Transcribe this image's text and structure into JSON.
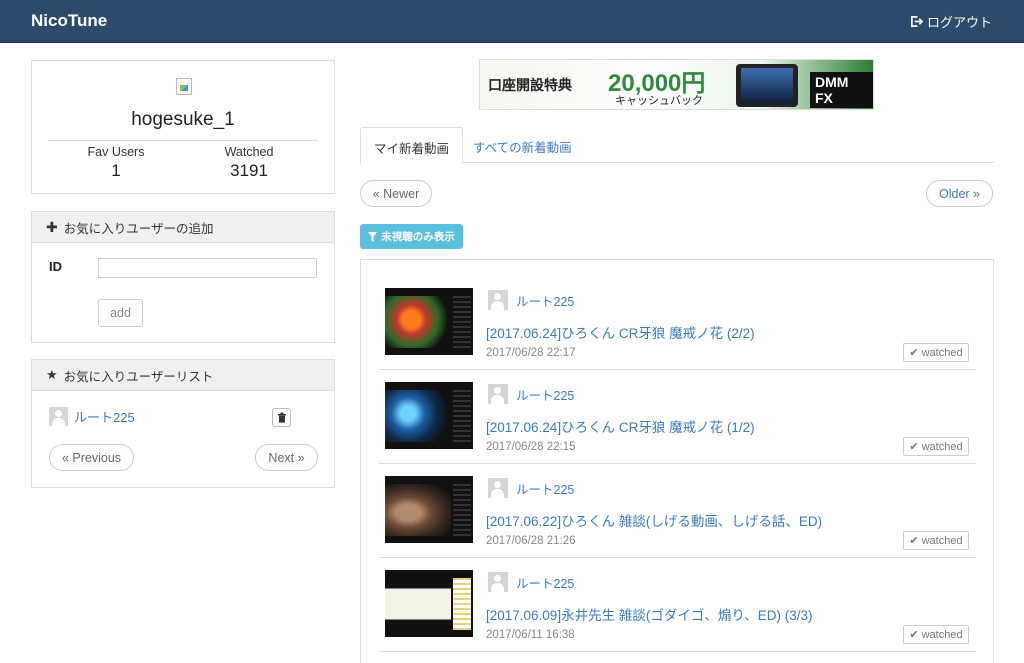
{
  "navbar": {
    "brand": "NicoTune",
    "logout_label": "ログアウト"
  },
  "profile": {
    "username": "hogesuke_1",
    "fav_users_label": "Fav Users",
    "fav_users_count": "1",
    "watched_label": "Watched",
    "watched_count": "3191"
  },
  "add_user": {
    "heading": "お気に入りユーザーの追加",
    "id_label": "ID",
    "id_value": "",
    "add_button": "add"
  },
  "fav_list": {
    "heading": "お気に入りユーザーリスト",
    "items": [
      {
        "name": "ルート225"
      }
    ],
    "prev_button": "« Previous",
    "next_button": "Next »"
  },
  "banner": {
    "line1": "口座開設特典",
    "amount": "20,000円",
    "sub": "キャッシュバック",
    "brand": "DMM FX"
  },
  "tabs": [
    {
      "label": "マイ新着動画",
      "active": true
    },
    {
      "label": "すべての新着動画",
      "active": false
    }
  ],
  "pager": {
    "newer": "« Newer",
    "older": "Older »"
  },
  "filter_button": "未視聴のみ表示",
  "videos": [
    {
      "user": "ルート225",
      "title": "[2017.06.24]ひろくん CR牙狼 魔戒ノ花 (2/2)",
      "date": "2017/06/28 22:17",
      "status": "watched"
    },
    {
      "user": "ルート225",
      "title": "[2017.06.24]ひろくん CR牙狼 魔戒ノ花 (1/2)",
      "date": "2017/06/28 22:15",
      "status": "watched"
    },
    {
      "user": "ルート225",
      "title": "[2017.06.22]ひろくん 雑談(しげる動画、しげる話、ED)",
      "date": "2017/06/28 21:26",
      "status": "watched"
    },
    {
      "user": "ルート225",
      "title": "[2017.06.09]永井先生 雑談(ゴダイゴ、煽り、ED) (3/3)",
      "date": "2017/06/11 16:38",
      "status": "watched"
    }
  ],
  "colors": {
    "navbar": "#2c4a6b",
    "link": "#3a7bbf",
    "filter_button": "#5bc0de"
  }
}
